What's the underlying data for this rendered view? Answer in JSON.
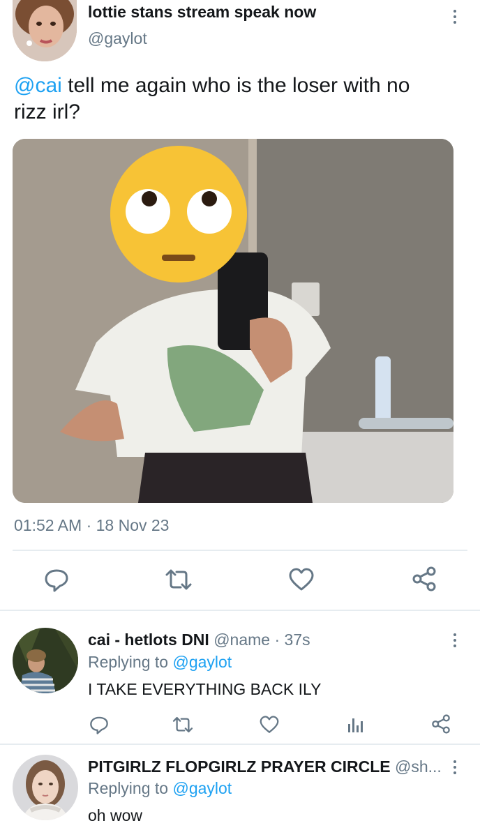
{
  "tweet": {
    "display_name": "lottie stans stream speak now",
    "handle": "@gaylot",
    "mention": "@cai",
    "text_line1": " tell me again who is the loser with no",
    "text_line2": "rizz irl?",
    "timestamp": "01:52 AM · 18 Nov 23",
    "actions": [
      "reply-icon",
      "retweet-icon",
      "like-icon",
      "share-icon"
    ]
  },
  "replies": [
    {
      "display_name": "cai - hetlots DNI",
      "handle": "@name",
      "time": " · 37s",
      "replying_prefix": "Replying to ",
      "replying_handle": "@gaylot",
      "text": "I TAKE EVERYTHING BACK ILY",
      "actions": [
        "reply-icon",
        "retweet-icon",
        "like-icon",
        "analytics-icon",
        "share-icon"
      ]
    },
    {
      "display_name": "PITGIRLZ FLOPGIRLZ PRAYER CIRCLE",
      "handle": "@sh...",
      "replying_prefix": "Replying to ",
      "replying_handle": "@gaylot",
      "text": "oh wow"
    }
  ],
  "colors": {
    "accent": "#1da1f2",
    "muted": "#657786",
    "divider": "#e6ecf0",
    "text": "#14171a"
  }
}
